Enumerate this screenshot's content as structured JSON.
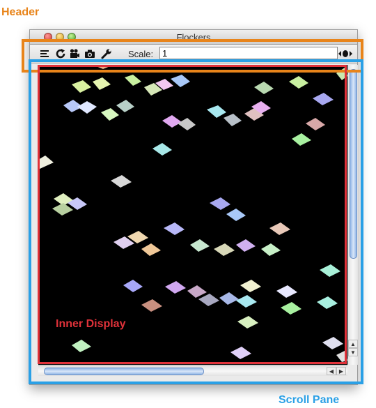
{
  "annotations": {
    "header": "Header",
    "scroll_pane": "Scroll Pane",
    "inner_display": "Inner Display"
  },
  "colors": {
    "header_box": "#e8841a",
    "scroll_pane_box": "#2aa0e6",
    "inner_display_box": "#e0323a",
    "display_background": "#000000"
  },
  "window": {
    "title": "Flockers"
  },
  "toolbar": {
    "icons": [
      "list-icon",
      "refresh-icon",
      "movie-camera-icon",
      "camera-icon",
      "wrench-icon",
      "eye-icon"
    ],
    "scale_label": "Scale:",
    "scale_value": "1"
  }
}
